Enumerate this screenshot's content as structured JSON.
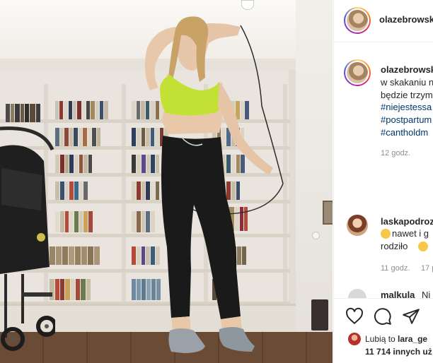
{
  "post": {
    "author": "olazebrowsk",
    "caption_author": "olazebrowski",
    "caption_lines": [
      "w skakaniu n",
      "będzie trzym"
    ],
    "hashtags": [
      "#niejestessa",
      "#postpartum",
      "#cantholdm"
    ],
    "posted_ago": "12 godz."
  },
  "comments": [
    {
      "user": "laskapodroz",
      "line1": " nawet i g",
      "line2": "rodziło ",
      "posted_ago": "11 godz.",
      "likes_fragment": "17 p"
    },
    {
      "user": "malkula",
      "text": "Ni"
    }
  ],
  "likes": {
    "liked_by_prefix": "Lubią to ",
    "liked_by_user": "lara_ge",
    "others": "11 714 innych uż"
  },
  "icons": {
    "like": "heart-icon",
    "comment": "comment-icon",
    "share": "share-icon"
  }
}
